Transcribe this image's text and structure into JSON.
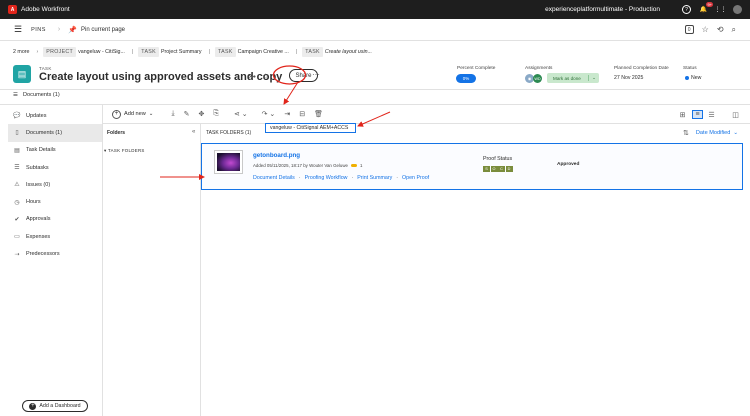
{
  "topbar": {
    "logo_text": "A",
    "app_name": "Adobe Workfront",
    "environment": "experienceplatformultimate - Production",
    "notification_count": "9+"
  },
  "pins": {
    "label": "PINS",
    "pin_current": "Pin current page"
  },
  "breadcrumb": {
    "more": "2 more",
    "items": [
      {
        "tag": "PROJECT",
        "label": "vangeluw - CitiSig..."
      },
      {
        "tag": "TASK",
        "label": "Project Summary"
      },
      {
        "tag": "TASK",
        "label": "Campaign Creative ..."
      },
      {
        "tag": "TASK",
        "label": "Create layout usin..."
      }
    ]
  },
  "header": {
    "type_tag": "TASK",
    "title": "Create layout using approved assets and copy",
    "share": "Share",
    "percent_label": "Percent Complete",
    "percent_value": "0%",
    "assign_label": "Assignments",
    "assignee_initials": "WD",
    "mark_done": "Mark as done",
    "planned_label": "Planned Completion Date",
    "planned_value": "27 Nov 2025",
    "status_label": "Status",
    "status_value": "New"
  },
  "docs_section": {
    "label": "Documents (1)"
  },
  "sidenav": {
    "items": [
      {
        "label": "Updates",
        "icon": "speech-bubble-icon"
      },
      {
        "label": "Documents (1)",
        "icon": "document-icon"
      },
      {
        "label": "Task Details",
        "icon": "details-icon"
      },
      {
        "label": "Subtasks",
        "icon": "subtasks-icon"
      },
      {
        "label": "Issues (0)",
        "icon": "issues-icon"
      },
      {
        "label": "Hours",
        "icon": "clock-icon"
      },
      {
        "label": "Approvals",
        "icon": "approvals-icon"
      },
      {
        "label": "Expenses",
        "icon": "expenses-icon"
      },
      {
        "label": "Predecessors",
        "icon": "predecessors-icon"
      }
    ],
    "add_dashboard": "Add a Dashboard"
  },
  "toolbar": {
    "add_new": "Add new"
  },
  "tooltip": {
    "text": "vangeluw - CitiSignal AEM+ACCS"
  },
  "folders": {
    "label": "Folders",
    "tree_item": "TASK FOLDERS"
  },
  "task_folders": {
    "label": "TASK FOLDERS (1)",
    "sort_label": "Date Modified"
  },
  "document": {
    "name": "getonboard.png",
    "meta": "Added 05/11/2025, 18:17 by Wouter Van Geluwe",
    "meta_count": "1",
    "links": [
      "Document Details",
      "Proofing Workflow",
      "Print Summary",
      "Open Proof"
    ],
    "proof_label": "Proof Status",
    "proof_boxes": [
      "S",
      "O",
      "C",
      "D"
    ],
    "approval": "Approved"
  },
  "colors": {
    "accent": "#1473e6",
    "annotation": "#e1251b",
    "task_icon": "#20a4a4",
    "proof_status": "#7a8c3c"
  }
}
